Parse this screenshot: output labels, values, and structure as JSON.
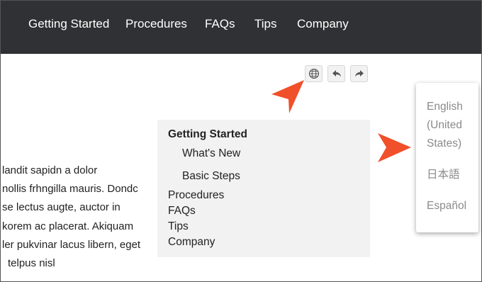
{
  "nav": {
    "items": [
      "Getting Started",
      "Procedures",
      "FAQs",
      "Tips",
      "Company"
    ]
  },
  "toolbar": {
    "language_icon": "globe-icon",
    "back_icon": "reply-arrow-icon",
    "forward_icon": "forward-arrow-icon"
  },
  "annotations": {
    "arrow_color": "#f0502a"
  },
  "body_text": {
    "lines": [
      "landit sapidn a dolor",
      "nollis frhngilla mauris. Dondc",
      "se lectus augte, auctor in",
      "korem ac placerat. Akiquam",
      "ler pukvinar lacus libern, eget",
      "telpus nisl"
    ]
  },
  "toc": {
    "heading": "Getting Started",
    "sub_items": [
      "What's New",
      "Basic Steps"
    ],
    "items": [
      "Procedures",
      "FAQs",
      "Tips",
      "Company"
    ]
  },
  "language_menu": {
    "options": [
      "English (United States)",
      "日本語",
      "Español"
    ]
  },
  "colors": {
    "nav_background": "#2f3134",
    "toc_background": "#f1f2f1",
    "menu_text": "#8a8a8a"
  }
}
